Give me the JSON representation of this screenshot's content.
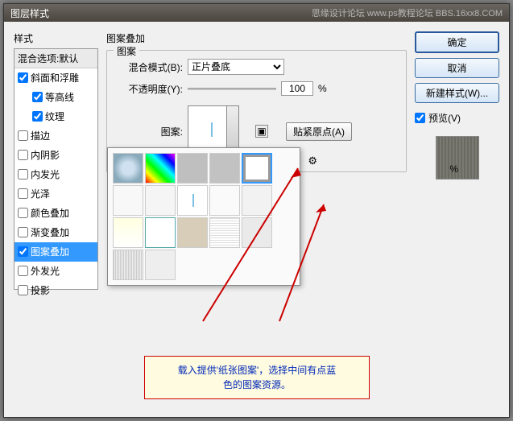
{
  "window": {
    "title": "图层样式",
    "watermark": "思缘设计论坛  www.ps教程论坛  BBS.16xx8.COM"
  },
  "left": {
    "header": "样式",
    "blend_options": "混合选项:默认",
    "items": [
      {
        "label": "斜面和浮雕",
        "checked": true,
        "indent": false
      },
      {
        "label": "等高线",
        "checked": true,
        "indent": true
      },
      {
        "label": "纹理",
        "checked": true,
        "indent": true
      },
      {
        "label": "描边",
        "checked": false,
        "indent": false
      },
      {
        "label": "内阴影",
        "checked": false,
        "indent": false
      },
      {
        "label": "内发光",
        "checked": false,
        "indent": false
      },
      {
        "label": "光泽",
        "checked": false,
        "indent": false
      },
      {
        "label": "颜色叠加",
        "checked": false,
        "indent": false
      },
      {
        "label": "渐变叠加",
        "checked": false,
        "indent": false
      },
      {
        "label": "图案叠加",
        "checked": true,
        "indent": false,
        "selected": true
      },
      {
        "label": "外发光",
        "checked": false,
        "indent": false
      },
      {
        "label": "投影",
        "checked": false,
        "indent": false
      }
    ]
  },
  "mid": {
    "title": "图案叠加",
    "group": "图案",
    "blend_mode_label": "混合模式(B):",
    "blend_mode_value": "正片叠底",
    "opacity_label": "不透明度(Y):",
    "opacity_value": "100",
    "pct": "%",
    "pattern_label": "图案:",
    "snap_btn": "贴紧原点(A)",
    "scale_pct": "%",
    "gear": "⚙"
  },
  "right": {
    "ok": "确定",
    "cancel": "取消",
    "new_style": "新建样式(W)...",
    "preview_label": "预览(V)"
  },
  "annotation": {
    "line1": "载入提供'纸张图案'，选择中间有点蓝",
    "line2": "色的图案资源。"
  }
}
